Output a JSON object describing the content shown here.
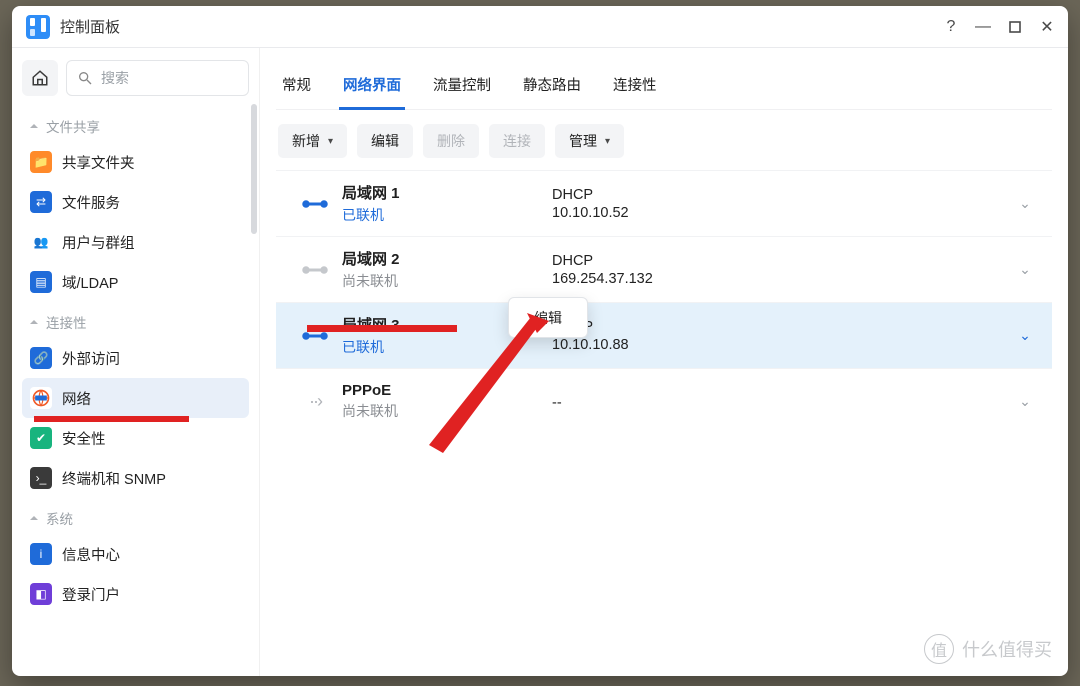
{
  "titlebar": {
    "title": "控制面板"
  },
  "search": {
    "placeholder": "搜索"
  },
  "groups": {
    "share": "文件共享",
    "connectivity": "连接性",
    "system": "系统"
  },
  "sidebar": {
    "share_folder": "共享文件夹",
    "file_services": "文件服务",
    "users_groups": "用户与群组",
    "domain_ldap": "域/LDAP",
    "external_access": "外部访问",
    "network": "网络",
    "security": "安全性",
    "terminal_snmp": "终端机和 SNMP",
    "info_center": "信息中心",
    "login_portal": "登录门户"
  },
  "tabs": {
    "general": "常规",
    "network_iface": "网络界面",
    "traffic": "流量控制",
    "static_route": "静态路由",
    "connectivity": "连接性"
  },
  "toolbar": {
    "add": "新增",
    "edit": "编辑",
    "delete": "删除",
    "connect": "连接",
    "manage": "管理"
  },
  "context": {
    "edit": "编辑"
  },
  "ifaces": [
    {
      "name": "局域网 1",
      "status": "已联机",
      "status_on": true,
      "proto": "DHCP",
      "addr": "10.10.10.52"
    },
    {
      "name": "局域网 2",
      "status": "尚未联机",
      "status_on": false,
      "proto": "DHCP",
      "addr": "169.254.37.132"
    },
    {
      "name": "局域网 3",
      "status": "已联机",
      "status_on": true,
      "proto": "DHCP",
      "addr": "10.10.10.88"
    },
    {
      "name": "PPPoE",
      "status": "尚未联机",
      "status_on": false,
      "proto": "",
      "addr": "--"
    }
  ],
  "watermark": {
    "text": "什么值得买",
    "glyph": "值"
  }
}
